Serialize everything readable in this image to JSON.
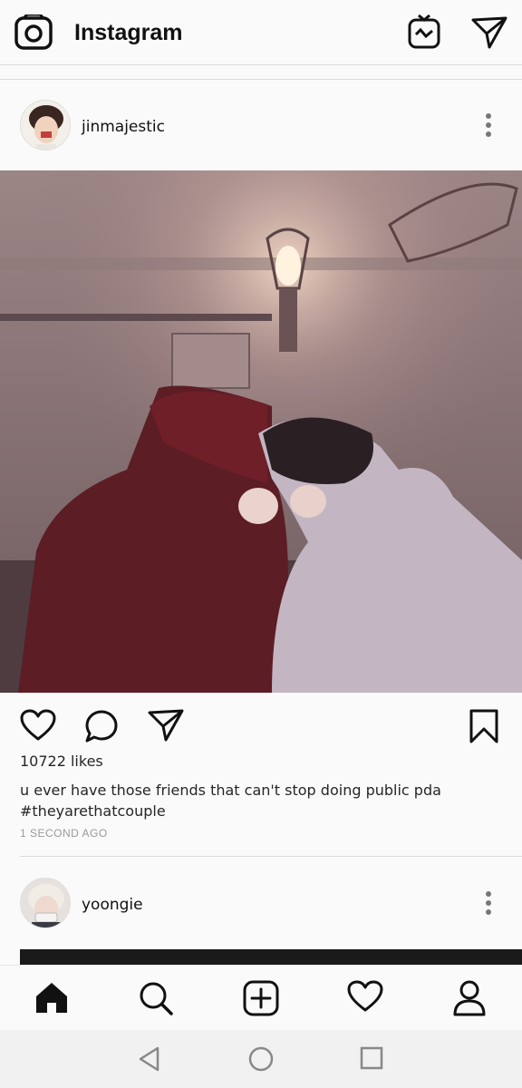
{
  "header": {
    "title": "Instagram",
    "icons": [
      "camera-icon",
      "igtv-icon",
      "direct-message-icon"
    ]
  },
  "posts": [
    {
      "username": "jinmajestic",
      "likes": "10722 likes",
      "caption_line1": "u ever have those friends that can't stop doing public pda",
      "caption_line2": "#theyarethatcouple",
      "time": "1 SECOND AGO"
    },
    {
      "username": "yoongie"
    }
  ],
  "post_actions": [
    "heart-icon",
    "comment-icon",
    "share-icon",
    "bookmark-icon"
  ],
  "bottom_nav": [
    "home-icon",
    "search-icon",
    "add-post-icon",
    "activity-heart-icon",
    "profile-icon"
  ],
  "system_nav": [
    "back-icon",
    "home-circle-icon",
    "recents-icon"
  ],
  "colors": {
    "background": "#fafafa",
    "text": "#262626",
    "muted": "#999999",
    "divider": "#dbdbdb"
  }
}
